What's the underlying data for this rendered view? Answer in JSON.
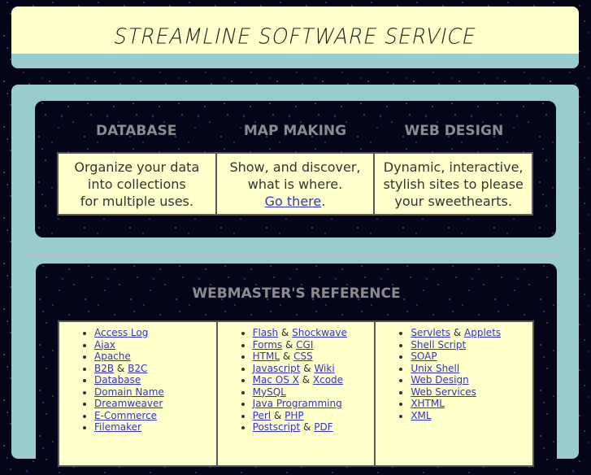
{
  "header": {
    "title": "STREAMLINE SOFTWARE SERVICE"
  },
  "services": [
    {
      "heading": "DATABASE",
      "lines": [
        "Organize your data",
        "into collections",
        "for multiple uses."
      ]
    },
    {
      "heading": "MAP MAKING",
      "lines": [
        "Show, and discover,",
        "what is where."
      ],
      "link_label": "Go there",
      "link_suffix": "."
    },
    {
      "heading": "WEB DESIGN",
      "lines": [
        "Dynamic, interactive,",
        "stylish sites to please",
        "your sweethearts."
      ]
    }
  ],
  "reference": {
    "title": "WEBMASTER'S REFERENCE",
    "columns": [
      [
        [
          "Access Log"
        ],
        [
          "Ajax"
        ],
        [
          "Apache"
        ],
        [
          "B2B",
          "B2C"
        ],
        [
          "Database"
        ],
        [
          "Domain Name"
        ],
        [
          "Dreamweaver"
        ],
        [
          "E-Commerce"
        ],
        [
          "Filemaker"
        ]
      ],
      [
        [
          "Flash",
          "Shockwave"
        ],
        [
          "Forms",
          "CGI"
        ],
        [
          "HTML",
          "CSS"
        ],
        [
          "Javascript",
          "Wiki"
        ],
        [
          "Mac OS X",
          "Xcode"
        ],
        [
          "MySQL"
        ],
        [
          "Java Programming"
        ],
        [
          "Perl",
          "PHP"
        ],
        [
          "Postscript",
          "PDF"
        ]
      ],
      [
        [
          "Servlets",
          "Applets"
        ],
        [
          "Shell Script"
        ],
        [
          "SOAP"
        ],
        [
          "Unix Shell"
        ],
        [
          "Web Design"
        ],
        [
          "Web Services"
        ],
        [
          "XHTML"
        ],
        [
          "XML"
        ]
      ]
    ],
    "joiner": "&"
  },
  "colors": {
    "cream": "#ffffcc",
    "teal": "#99cccc",
    "heading_gray": "#8c8c8c",
    "link": "#3333cc"
  }
}
